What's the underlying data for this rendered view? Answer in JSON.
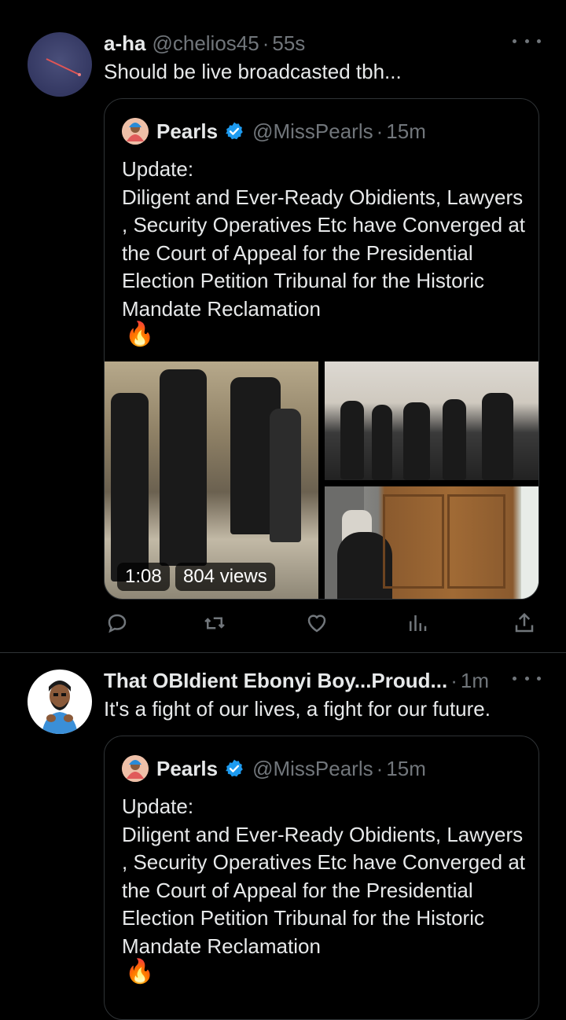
{
  "tweets": [
    {
      "name": "a-ha",
      "handle": "@chelios45",
      "time": "55s",
      "text": "Should be live broadcasted tbh...",
      "avatar_icon": "meteor-icon",
      "quote": {
        "name": "Pearls",
        "handle": "@MissPearls",
        "time": "15m",
        "text": "Update:\nDiligent and Ever-Ready Obidients, Lawyers , Security Operatives Etc have Converged at the Court of Appeal for the Presidential Election Petition Tribunal for the Historic Mandate Reclamation",
        "emoji": "🔥",
        "video_duration": "1:08",
        "video_views": "804 views"
      }
    },
    {
      "name": "That OBIdient Ebonyi Boy...Proud...",
      "handle": "",
      "time": "1m",
      "text": "It's a fight of our lives, a fight for our future.",
      "avatar_icon": "cartoon-man-avatar",
      "quote": {
        "name": "Pearls",
        "handle": "@MissPearls",
        "time": "15m",
        "text": "Update:\nDiligent and Ever-Ready Obidients, Lawyers , Security Operatives Etc have Converged at the Court of Appeal for the Presidential Election Petition Tribunal for the Historic Mandate Reclamation",
        "emoji": "🔥"
      }
    }
  ],
  "actions": [
    "reply-icon",
    "retweet-icon",
    "like-icon",
    "views-icon",
    "share-icon"
  ],
  "colors": {
    "background": "#000000",
    "text": "#e7e9ea",
    "muted": "#71767b",
    "border": "#2f3336",
    "verified": "#1d9bf0"
  }
}
